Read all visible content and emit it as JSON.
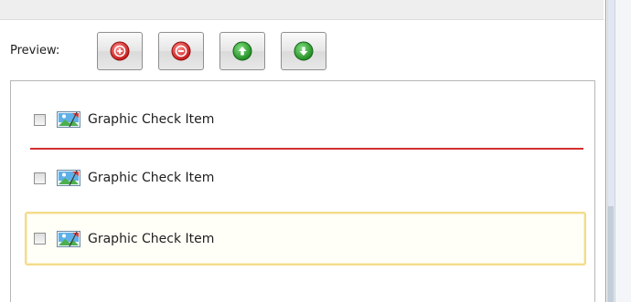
{
  "preview": {
    "label": "Preview:"
  },
  "toolbar": {
    "buttons": [
      {
        "name": "add-button",
        "icon": "plus-circle-icon",
        "color": "#d62c2c"
      },
      {
        "name": "remove-button",
        "icon": "minus-circle-icon",
        "color": "#d62c2c"
      },
      {
        "name": "move-up-button",
        "icon": "arrow-up-circle-icon",
        "color": "#2e9b2e"
      },
      {
        "name": "move-down-button",
        "icon": "arrow-down-circle-icon",
        "color": "#2e9b2e"
      }
    ]
  },
  "list": {
    "items": [
      {
        "label": "Graphic Check Item",
        "checked": false,
        "icon": "picture-icon",
        "selected": false
      },
      {
        "label": "Graphic Check Item",
        "checked": false,
        "icon": "picture-icon",
        "selected": false
      },
      {
        "label": "Graphic Check Item",
        "checked": false,
        "icon": "picture-icon",
        "selected": true
      }
    ],
    "drop_indicator_color": "#d32f2f",
    "selection_border_color": "#f2dc8c"
  }
}
